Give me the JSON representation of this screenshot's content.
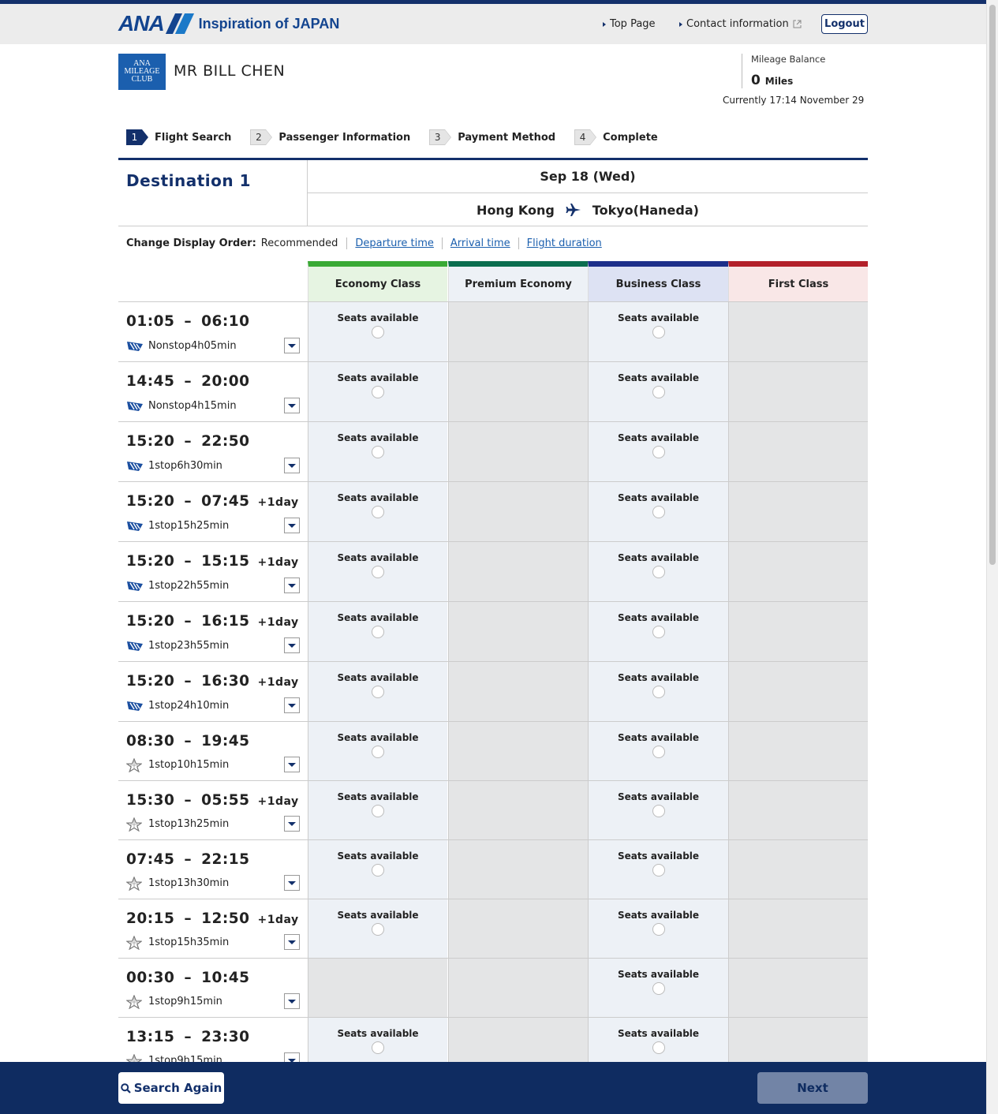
{
  "header": {
    "logo_text": "ANA",
    "logo_tagline": "Inspiration of JAPAN",
    "links": {
      "top_page": "Top Page",
      "contact": "Contact information"
    },
    "logout": "Logout"
  },
  "member": {
    "club_logo_lines": [
      "ANA",
      "MILEAGE",
      "CLUB"
    ],
    "name": "MR BILL CHEN",
    "mileage_label": "Mileage Balance",
    "mileage_value": "0",
    "mileage_unit": "Miles",
    "currently": "Currently 17:14 November 29"
  },
  "steps": [
    {
      "num": "1",
      "label": "Flight Search",
      "active": true
    },
    {
      "num": "2",
      "label": "Passenger Information",
      "active": false
    },
    {
      "num": "3",
      "label": "Payment Method",
      "active": false
    },
    {
      "num": "4",
      "label": "Complete",
      "active": false
    }
  ],
  "destination": {
    "title": "Destination 1",
    "date": "Sep 18 (Wed)",
    "from": "Hong Kong",
    "to": "Tokyo(Haneda)"
  },
  "display_order": {
    "label": "Change Display Order:",
    "current": "Recommended",
    "options": [
      "Departure time",
      "Arrival time",
      "Flight duration"
    ]
  },
  "classes": [
    {
      "name": "Economy Class",
      "color": "#3aaa35",
      "bg": "#e6f4e2"
    },
    {
      "name": "Premium Economy",
      "color": "#0b6e4f",
      "bg": "#edf1f6"
    },
    {
      "name": "Business Class",
      "color": "#1c2f8a",
      "bg": "#dde2f3"
    },
    {
      "name": "First Class",
      "color": "#b3202a",
      "bg": "#f9e7e7"
    }
  ],
  "seats_label": "Seats available",
  "flights": [
    {
      "dep": "01:05",
      "arr": "06:10",
      "plus": "",
      "info": "Nonstop4h05min",
      "carrier": "ana",
      "avail": [
        true,
        false,
        true,
        false
      ]
    },
    {
      "dep": "14:45",
      "arr": "20:00",
      "plus": "",
      "info": "Nonstop4h15min",
      "carrier": "ana",
      "avail": [
        true,
        false,
        true,
        false
      ]
    },
    {
      "dep": "15:20",
      "arr": "22:50",
      "plus": "",
      "info": "1stop6h30min",
      "carrier": "ana",
      "avail": [
        true,
        false,
        true,
        false
      ]
    },
    {
      "dep": "15:20",
      "arr": "07:45",
      "plus": "+1day",
      "info": "1stop15h25min",
      "carrier": "ana",
      "avail": [
        true,
        false,
        true,
        false
      ]
    },
    {
      "dep": "15:20",
      "arr": "15:15",
      "plus": "+1day",
      "info": "1stop22h55min",
      "carrier": "ana",
      "avail": [
        true,
        false,
        true,
        false
      ]
    },
    {
      "dep": "15:20",
      "arr": "16:15",
      "plus": "+1day",
      "info": "1stop23h55min",
      "carrier": "ana",
      "avail": [
        true,
        false,
        true,
        false
      ]
    },
    {
      "dep": "15:20",
      "arr": "16:30",
      "plus": "+1day",
      "info": "1stop24h10min",
      "carrier": "ana",
      "avail": [
        true,
        false,
        true,
        false
      ]
    },
    {
      "dep": "08:30",
      "arr": "19:45",
      "plus": "",
      "info": "1stop10h15min",
      "carrier": "star",
      "avail": [
        true,
        false,
        true,
        false
      ]
    },
    {
      "dep": "15:30",
      "arr": "05:55",
      "plus": "+1day",
      "info": "1stop13h25min",
      "carrier": "star",
      "avail": [
        true,
        false,
        true,
        false
      ]
    },
    {
      "dep": "07:45",
      "arr": "22:15",
      "plus": "",
      "info": "1stop13h30min",
      "carrier": "star",
      "avail": [
        true,
        false,
        true,
        false
      ]
    },
    {
      "dep": "20:15",
      "arr": "12:50",
      "plus": "+1day",
      "info": "1stop15h35min",
      "carrier": "star",
      "avail": [
        true,
        false,
        true,
        false
      ]
    },
    {
      "dep": "00:30",
      "arr": "10:45",
      "plus": "",
      "info": "1stop9h15min",
      "carrier": "star",
      "avail": [
        false,
        false,
        true,
        false
      ]
    },
    {
      "dep": "13:15",
      "arr": "23:30",
      "plus": "",
      "info": "1stop9h15min",
      "carrier": "star",
      "avail": [
        true,
        false,
        true,
        false
      ]
    }
  ],
  "footer": {
    "search_again": "Search Again",
    "next": "Next"
  }
}
